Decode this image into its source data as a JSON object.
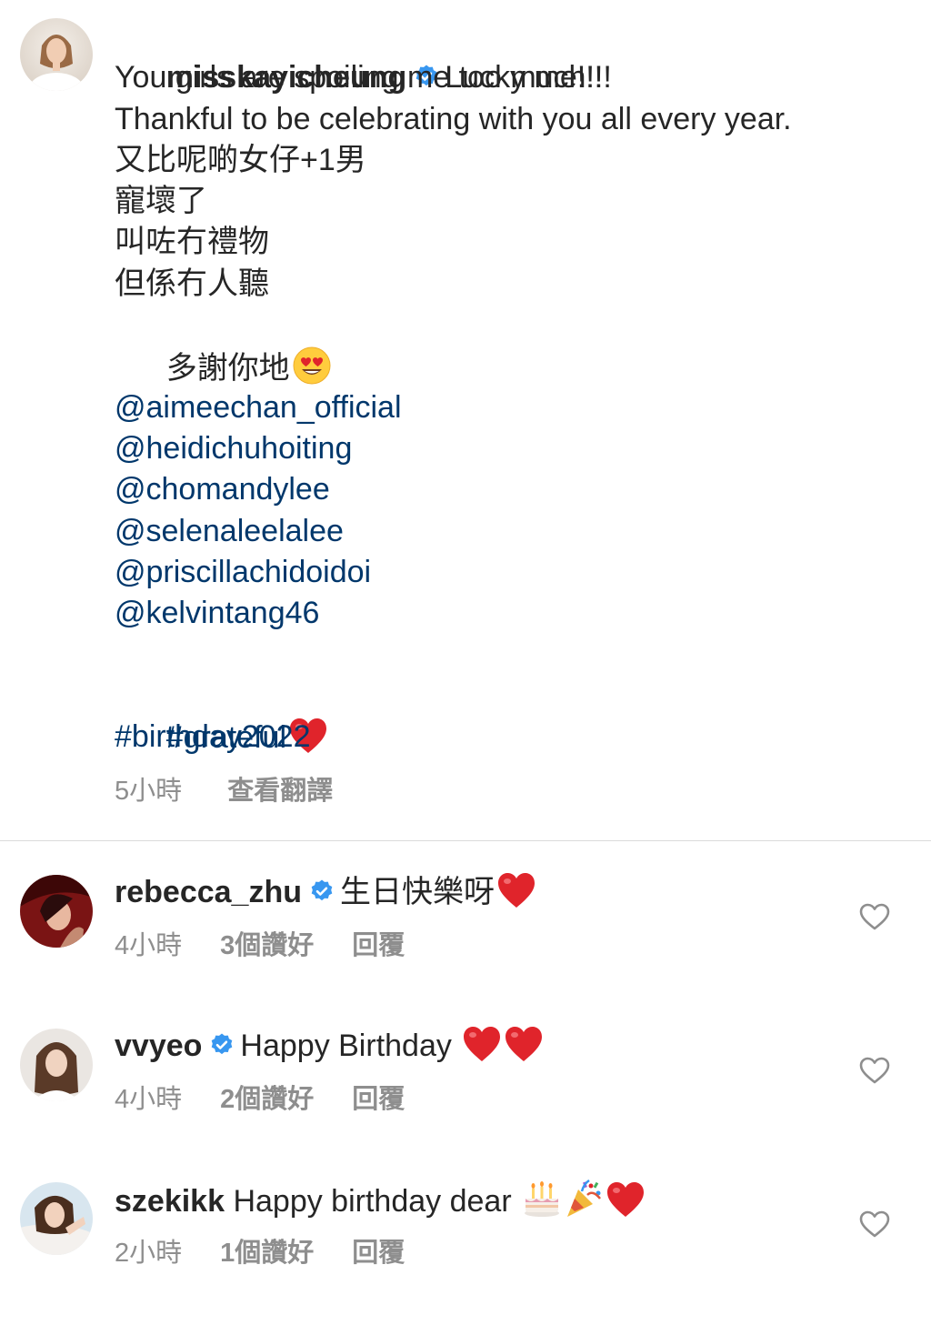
{
  "caption": {
    "username": "misskayicheung",
    "verified": true,
    "lines": [
      "Lucky me!!!",
      "You girls are spoiling me too much!!!",
      "Thankful to be celebrating with you all every year.",
      "又比呢啲女仔+1男",
      "寵壞了",
      "叫咗冇禮物",
      "但係冇人聽",
      "多謝你地"
    ],
    "mentions": [
      "@aimeechan_official",
      "@heidichuhoiting",
      "@chomandylee",
      "@selenaleelalee",
      "@priscillachidoidoi",
      "@kelvintang46"
    ],
    "hashtags": [
      "#grateful",
      "#birthday2022"
    ],
    "time": "5小時",
    "translate": "查看翻譯"
  },
  "comments": [
    {
      "username": "rebecca_zhu",
      "verified": true,
      "text": "生日快樂呀",
      "emojis": [
        "red-heart"
      ],
      "time": "4小時",
      "likes": "3個讚好",
      "reply": "回覆"
    },
    {
      "username": "vvyeo",
      "verified": true,
      "text": "Happy Birthday ",
      "emojis": [
        "red-heart",
        "red-heart"
      ],
      "time": "4小時",
      "likes": "2個讚好",
      "reply": "回覆"
    },
    {
      "username": "szekikk",
      "verified": false,
      "text": "Happy birthday dear ",
      "emojis": [
        "birthday-cake",
        "party-popper",
        "red-heart"
      ],
      "time": "2小時",
      "likes": "1個讚好",
      "reply": "回覆"
    }
  ],
  "colors": {
    "text": "#262626",
    "link": "#00376b",
    "meta": "#8e8e8e",
    "verified": "#3897f0",
    "divider": "#dbdbdb",
    "heart": "#e0242b"
  }
}
